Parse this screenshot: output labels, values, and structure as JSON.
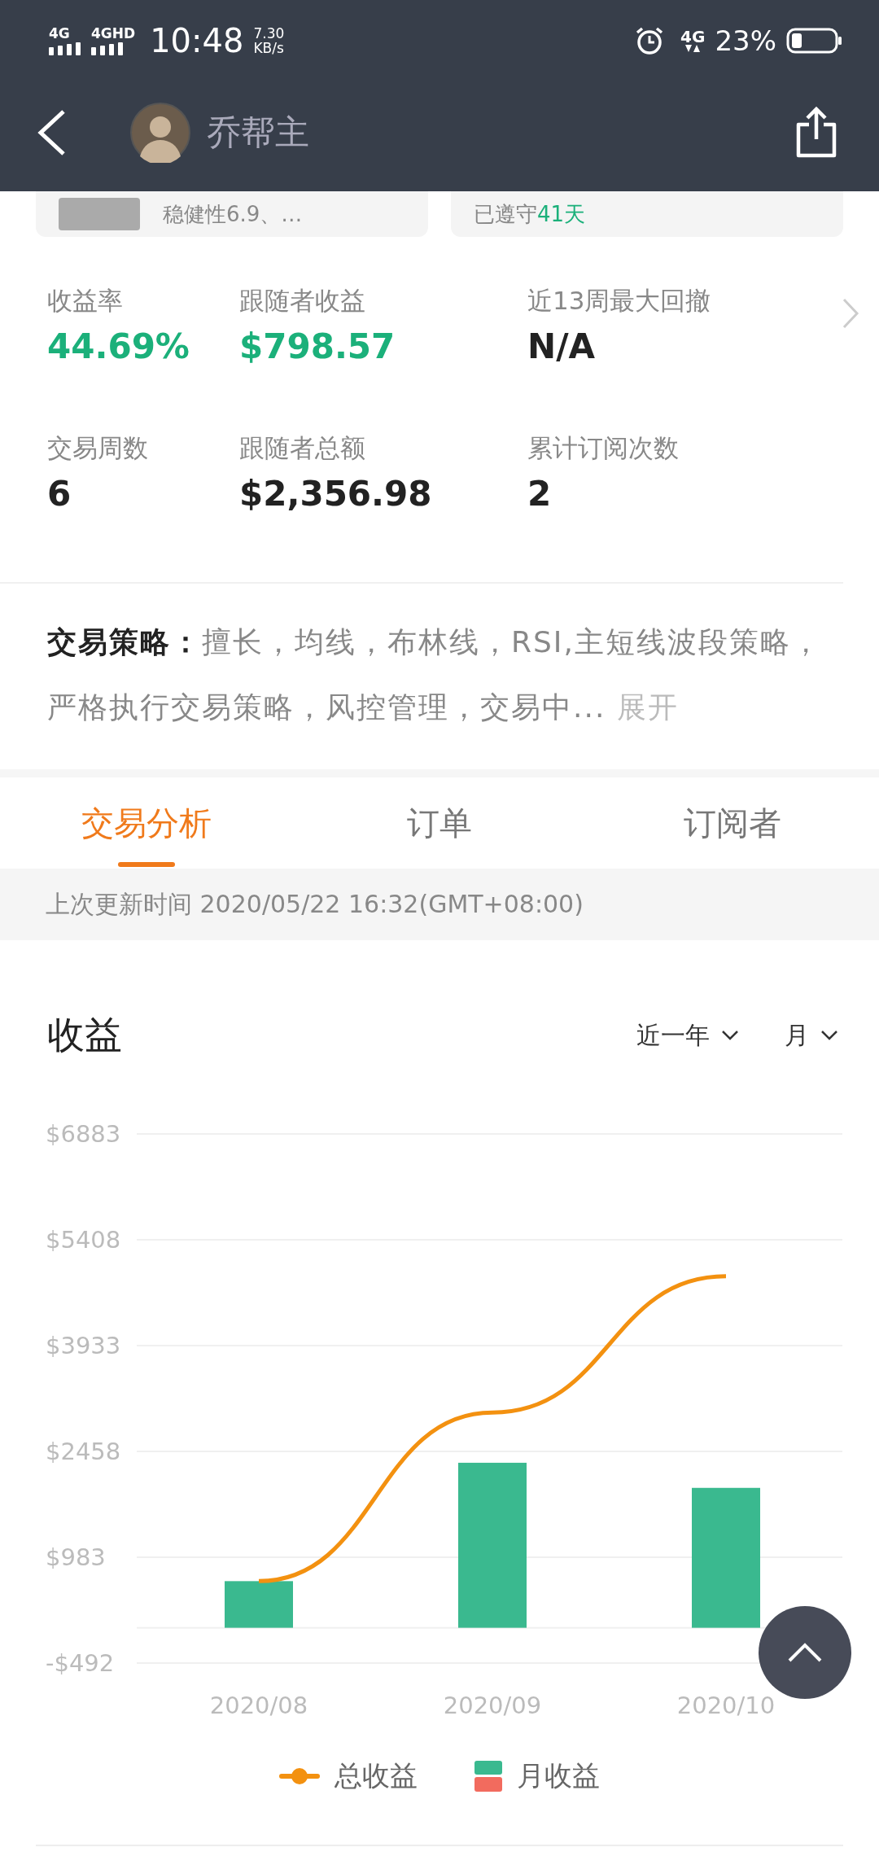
{
  "status_bar": {
    "signals": [
      "4G",
      "4GHD"
    ],
    "time": "10:48",
    "speed": "7.30",
    "speed_unit": "KB/s",
    "network": "4G",
    "battery": "23%"
  },
  "header": {
    "name": "乔帮主"
  },
  "cards": [
    {
      "text": "稳健性6.9、…"
    },
    {
      "text": "已遵守",
      "highlight": "41天"
    }
  ],
  "stats": [
    {
      "label": "收益率",
      "value": "44.69%",
      "positive": true
    },
    {
      "label": "跟随者收益",
      "value": "$798.57",
      "positive": true
    },
    {
      "label": "近13周最大回撤",
      "value": "N/A",
      "positive": false
    },
    {
      "label": "交易周数",
      "value": "6",
      "positive": false
    },
    {
      "label": "跟随者总额",
      "value": "$2,356.98",
      "positive": false
    },
    {
      "label": "累计订阅次数",
      "value": "2",
      "positive": false
    }
  ],
  "strategy": {
    "label": "交易策略：",
    "text": "擅长，均线，布林线，RSI,主短线波段策略，严格执行交易策略，风控管理，交易中...",
    "more": "展开"
  },
  "tabs": [
    {
      "label": "交易分析",
      "selected": true
    },
    {
      "label": "订单",
      "selected": false
    },
    {
      "label": "订阅者",
      "selected": false
    }
  ],
  "update_time": "上次更新时间 2020/05/22 16:32(GMT+08:00)",
  "earnings": {
    "title": "收益",
    "filters": [
      "近一年",
      "月"
    ],
    "chart_data": {
      "type": "bar",
      "categories": [
        "2020/08",
        "2020/09",
        "2020/10"
      ],
      "stacked": false,
      "grid": true,
      "series": [
        {
          "name": "总收益",
          "color": "#f39110",
          "type": "line",
          "values": [
            650,
            3000,
            4900
          ]
        },
        {
          "name": "月收益",
          "color": "#3ab98f",
          "values": [
            650,
            2300,
            1950
          ]
        }
      ],
      "ylim": [
        -492,
        6883
      ],
      "yticks": [
        {
          "value": -492,
          "label": "-$492"
        },
        {
          "value": 983,
          "label": "$983"
        },
        {
          "value": 2458,
          "label": "$2458"
        },
        {
          "value": 3933,
          "label": "$3933"
        },
        {
          "value": 5408,
          "label": "$5408"
        },
        {
          "value": 6883,
          "label": "$6883"
        }
      ]
    }
  }
}
